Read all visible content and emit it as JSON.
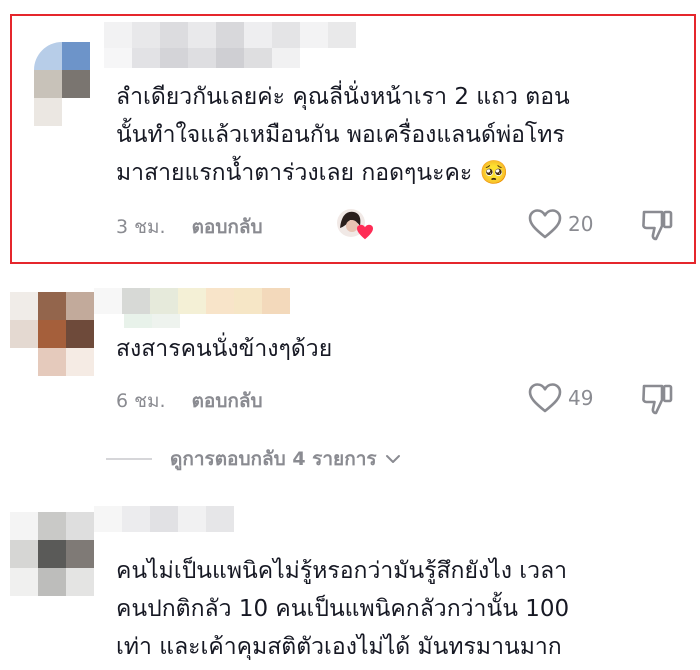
{
  "comments": [
    {
      "text_lines": [
        "ลำเดียวกันเลยค่ะ คุณลี่นั่งหน้าเรา 2 แถว ตอน",
        "นั้นทำใจแล้วเหมือนกัน พอเครื่องแลนด์พ่อโทร",
        "มาสายแรกน้ำตาร่วงเลย กอดๆนะคะ 🥺"
      ],
      "time": "3 ชม.",
      "reply_label": "ตอบกลับ",
      "likes": "20",
      "creator_liked": true,
      "highlighted": true
    },
    {
      "text_lines": [
        "สงสารคนนั่งข้างๆด้วย"
      ],
      "time": "6 ชม.",
      "reply_label": "ตอบกลับ",
      "likes": "49"
    },
    {
      "text_lines": [
        "คนไม่เป็นแพนิคไม่รู้หรอกว่ามันรู้สึกยังไง เวลา",
        "คนปกติกลัว 10 คนเป็นแพนิคกลัวกว่านั้น 100",
        "เท่า และเค้าคุมสติตัวเองไม่ได้ มันทรมานมาก"
      ]
    }
  ],
  "view_replies": {
    "label": "ดูการตอบกลับ 4 รายการ"
  },
  "colors": {
    "highlight_border": "#e5262c",
    "meta_text": "#8a8b91",
    "heart_badge": "#fe2c55"
  },
  "icons": {
    "like": "heart-outline-icon",
    "dislike": "thumbs-down-icon",
    "chevron": "chevron-down-icon"
  }
}
